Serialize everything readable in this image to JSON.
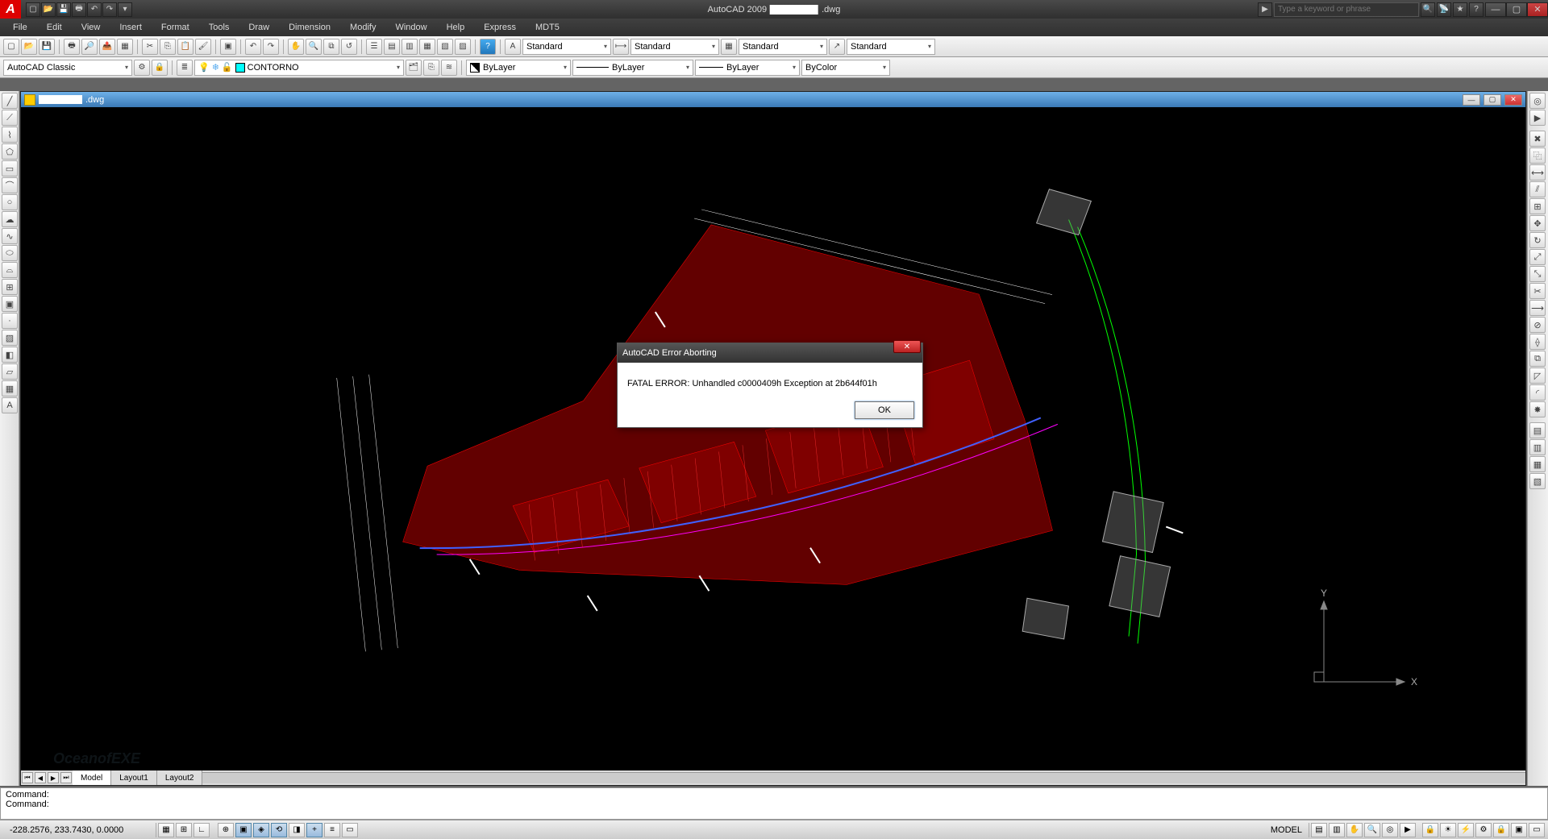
{
  "titlebar": {
    "app_name_prefix": "AutoCAD 2009",
    "doc_suffix": ".dwg",
    "search_placeholder": "Type a keyword or phrase"
  },
  "menubar": [
    "File",
    "Edit",
    "View",
    "Insert",
    "Format",
    "Tools",
    "Draw",
    "Dimension",
    "Modify",
    "Window",
    "Help",
    "Express",
    "MDT5"
  ],
  "toolbar2": {
    "workspace": "AutoCAD Classic",
    "layer": "CONTORNO",
    "style1": "Standard",
    "style2": "Standard",
    "style3": "Standard",
    "style4": "Standard",
    "bylayer1": "ByLayer",
    "bylayer2": "ByLayer",
    "bylayer3": "ByLayer",
    "bycolor": "ByColor"
  },
  "doc": {
    "title": ".dwg"
  },
  "ucs": {
    "x": "X",
    "y": "Y"
  },
  "tabs": {
    "model": "Model",
    "layout1": "Layout1",
    "layout2": "Layout2"
  },
  "cmd": {
    "l1": "Command:",
    "l2": "Command:"
  },
  "status": {
    "coords": "-228.2576, 233.7430, 0.0000",
    "model": "MODEL"
  },
  "error": {
    "title": "AutoCAD Error Aborting",
    "message": "FATAL ERROR:   Unhandled c0000409h Exception at 2b644f01h",
    "ok": "OK"
  },
  "watermark": "OceanofEXE"
}
